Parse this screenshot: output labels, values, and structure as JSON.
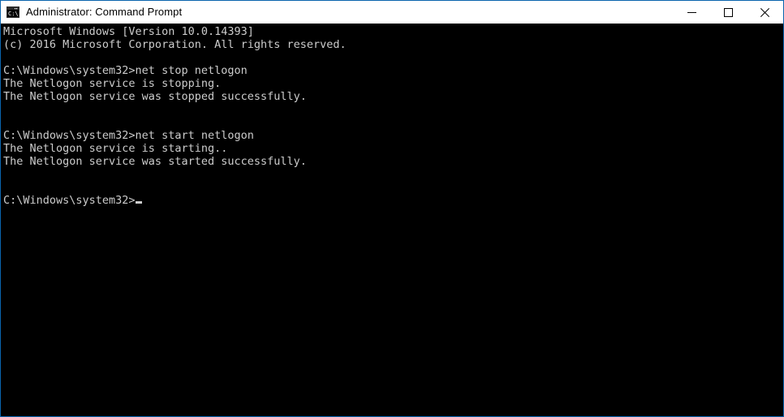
{
  "window": {
    "title": "Administrator: Command Prompt",
    "icon": "console-window-icon",
    "border_color": "#0a64ad",
    "titlebar_bg": "#ffffff",
    "titlebar_text_color": "#000000"
  },
  "controls": {
    "minimize_label": "Minimize",
    "maximize_label": "Maximize",
    "close_label": "Close"
  },
  "console": {
    "background": "#000000",
    "foreground": "#cccccc",
    "cursor": "_",
    "prompt": "C:\\Windows\\system32>",
    "lines": [
      "Microsoft Windows [Version 10.0.14393]",
      "(c) 2016 Microsoft Corporation. All rights reserved.",
      "",
      "C:\\Windows\\system32>net stop netlogon",
      "The Netlogon service is stopping.",
      "The Netlogon service was stopped successfully.",
      "",
      "",
      "C:\\Windows\\system32>net start netlogon",
      "The Netlogon service is starting..",
      "The Netlogon service was started successfully.",
      "",
      "",
      "C:\\Windows\\system32>"
    ]
  }
}
